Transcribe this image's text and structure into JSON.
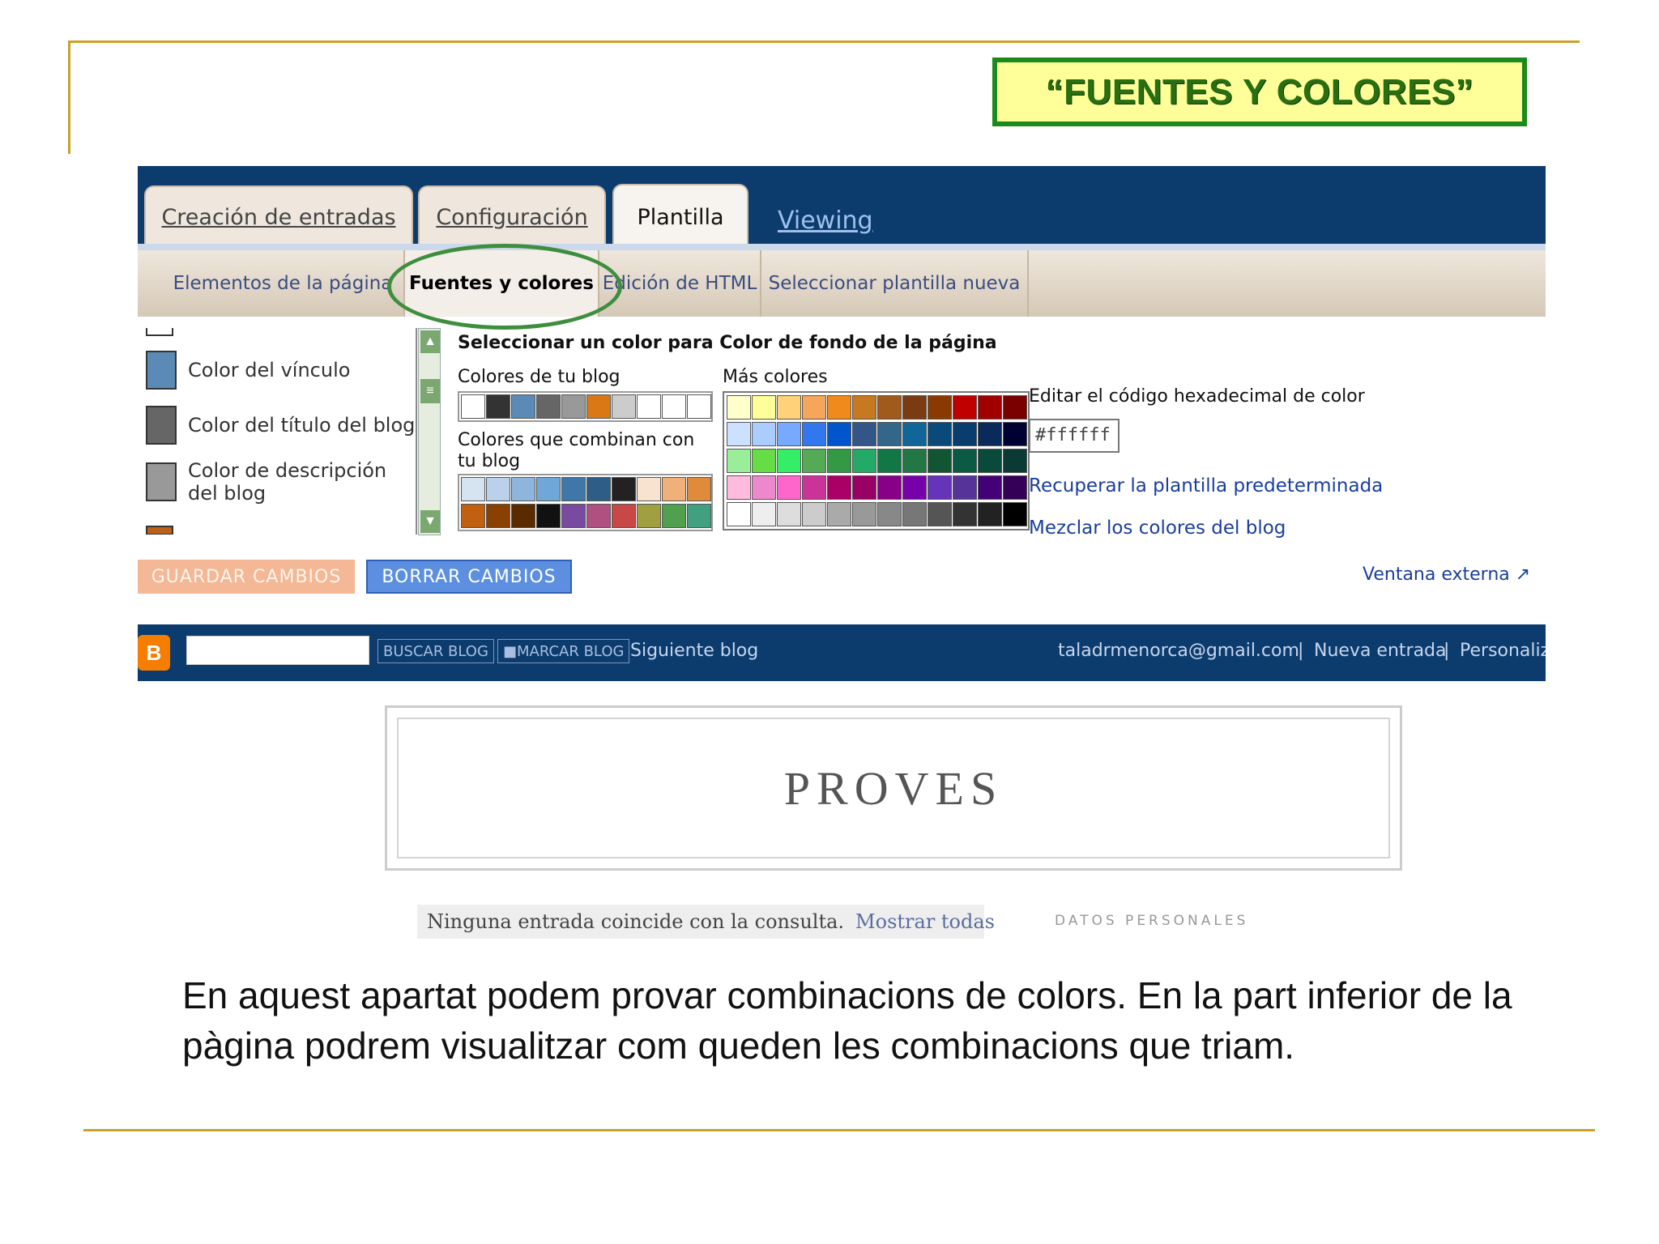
{
  "slide": {
    "title": "“FUENTES Y COLORES”",
    "caption": "En aquest apartat podem provar combinacions de colors. En la part inferior de la pàgina podrem visualitzar com queden les combinacions que triam."
  },
  "tabs": [
    {
      "label": "Creación de entradas"
    },
    {
      "label": "Configuración"
    },
    {
      "label": "Plantilla"
    },
    {
      "label": "Viewing"
    }
  ],
  "subtabs": [
    {
      "label": "Elementos de la página"
    },
    {
      "label": "Fuentes y colores"
    },
    {
      "label": "Edición de HTML"
    },
    {
      "label": "Seleccionar plantilla nueva"
    }
  ],
  "left_list": [
    {
      "label": "Color del vínculo",
      "color": "#5a8ab5"
    },
    {
      "label": "Color del título del blog",
      "color": "#666666"
    },
    {
      "label": "Color de descripción del blog",
      "color": "#999999"
    }
  ],
  "picker": {
    "heading": "Seleccionar un color para Color de fondo de la página",
    "blog_colors_label": "Colores de tu blog",
    "blog_colors": [
      "#ffffff",
      "#333333",
      "#5a8ab5",
      "#666666",
      "#999999",
      "#d97814",
      "#cccccc",
      "#ffffff",
      "#ffffff",
      "#ffffff",
      "#ffffff",
      "#ffffff",
      "#ffffff",
      "#ffffff",
      "#ffffff",
      "#ffffff",
      "#ffffff",
      "#ffffff",
      "#ffffff",
      "#ffffff",
      "#ffffff",
      "#ffffff",
      "#ffffff",
      "#ffffff",
      "#ffffff",
      "#ffffff",
      "#ffffff",
      "#ffffff",
      "#ffffff",
      "#ffffff"
    ],
    "matching_label": "Colores que combinan con tu blog",
    "matching_colors": [
      "#d6e4f2",
      "#b9d1ea",
      "#8fb5dd",
      "#6fa7d8",
      "#3f78a8",
      "#2e5d85",
      "#222222",
      "#f7e3cf",
      "#f0b07a",
      "#e08a3c",
      "#c06010",
      "#8a4000",
      "#5a2a00",
      "#111111",
      "#7a4aa0",
      "#b05080",
      "#c84848",
      "#a0a040",
      "#50a050",
      "#40a080"
    ],
    "more_label": "Más colores",
    "more_colors": [
      "#ffffcc",
      "#ffff99",
      "#ffd27a",
      "#f5a65b",
      "#f08a1c",
      "#c8781e",
      "#a05a1c",
      "#7a3a12",
      "#8a3a00",
      "#c00000",
      "#a00000",
      "#7a0000",
      "#cce0ff",
      "#aaccff",
      "#77aaff",
      "#3377ee",
      "#0055cc",
      "#335588",
      "#336688",
      "#116699",
      "#0a4a7a",
      "#0b3c6e",
      "#0a2a5a",
      "#000033",
      "#99ee99",
      "#66dd44",
      "#33ee66",
      "#55aa55",
      "#339944",
      "#22aa66",
      "#117744",
      "#227744",
      "#115533",
      "#0a5a44",
      "#0a4a3a",
      "#0a3a33",
      "#ffbbdd",
      "#ee88cc",
      "#ff66cc",
      "#cc3399",
      "#aa0066",
      "#990066",
      "#880088",
      "#7700aa",
      "#6633bb",
      "#553399",
      "#440077",
      "#330055",
      "#ffffff",
      "#eeeeee",
      "#dddddd",
      "#cccccc",
      "#aaaaaa",
      "#999999",
      "#888888",
      "#777777",
      "#555555",
      "#333333",
      "#222222",
      "#000000"
    ],
    "hex_label": "Editar el código hexadecimal de color",
    "hex_value": "#ffffff",
    "restore_link": "Recuperar la plantilla predeterminada",
    "mix_link": "Mezclar los colores del blog"
  },
  "buttons": {
    "save": "GUARDAR CAMBIOS",
    "clear": "BORRAR CAMBIOS",
    "external": "Ventana externa"
  },
  "navbar": {
    "search_button": "BUSCAR BLOG",
    "flag_button": "MARCAR BLOG",
    "next_blog": "Siguiente blog",
    "email": "taladrmenorca@gmail.com",
    "new_post": "Nueva entrada",
    "customize": "Personalizar"
  },
  "blog": {
    "title": "PROVES",
    "no_match": "Ninguna entrada coincide con la consulta.",
    "show_all": "Mostrar todas",
    "profile_heading": "DATOS PERSONALES"
  }
}
